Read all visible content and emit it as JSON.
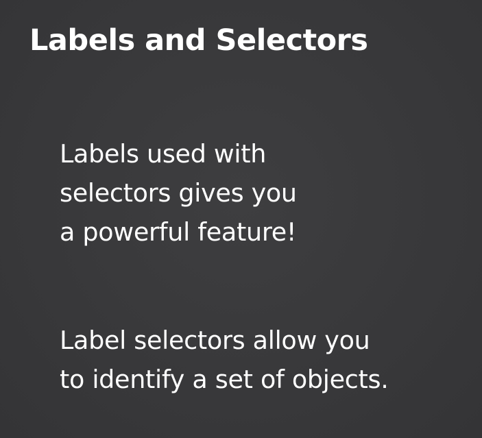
{
  "slide": {
    "title": "Labels and Selectors",
    "paragraphs": [
      {
        "lines": [
          "Labels used with",
          "selectors gives you",
          "a powerful feature!"
        ]
      },
      {
        "lines": [
          "Label selectors allow you",
          "to identify a set of objects."
        ]
      }
    ]
  },
  "colors": {
    "background": "#3a3a3b",
    "text": "#ffffff"
  }
}
